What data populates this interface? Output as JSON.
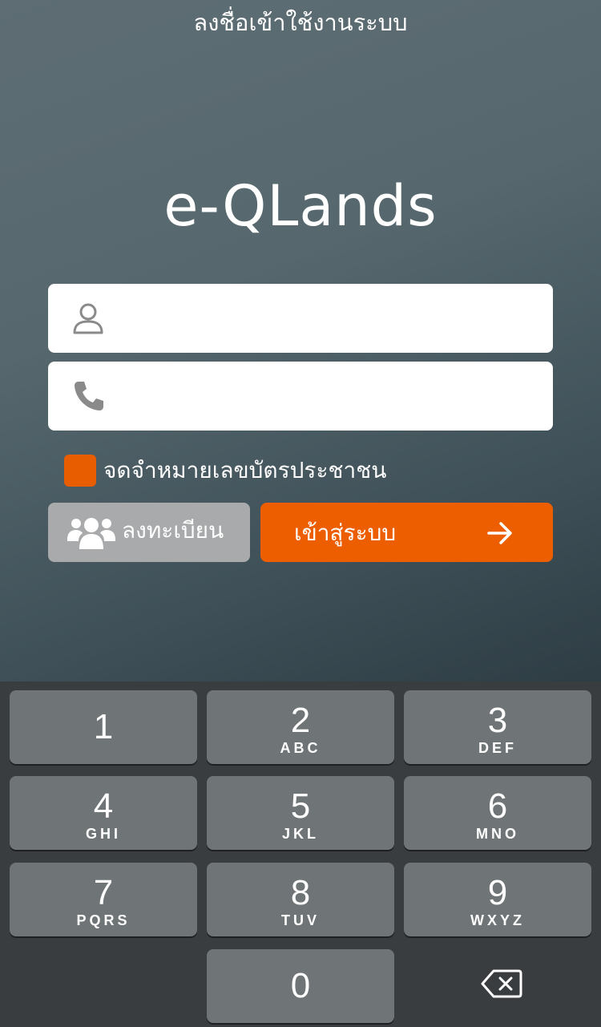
{
  "header": {
    "title": "ลงชื่อเข้าใช้งานระบบ"
  },
  "app": {
    "logo_text": "e-QLands"
  },
  "form": {
    "username": {
      "icon": "user-icon",
      "value": "",
      "placeholder": ""
    },
    "phone": {
      "icon": "phone-icon",
      "value": "",
      "placeholder": ""
    },
    "remember": {
      "label": "จดจำหมายเลขบัตรประชาชน",
      "checked": true,
      "color": "#e85d00"
    }
  },
  "buttons": {
    "register": {
      "label": "ลงทะเบียน",
      "icon": "people-icon",
      "color": "#a8aaab"
    },
    "login": {
      "label": "เข้าสู่ระบบ",
      "icon": "arrow-right-icon",
      "color": "#ed5e00"
    }
  },
  "keypad": {
    "keys": [
      {
        "digit": "1",
        "letters": ""
      },
      {
        "digit": "2",
        "letters": "ABC"
      },
      {
        "digit": "3",
        "letters": "DEF"
      },
      {
        "digit": "4",
        "letters": "GHI"
      },
      {
        "digit": "5",
        "letters": "JKL"
      },
      {
        "digit": "6",
        "letters": "MNO"
      },
      {
        "digit": "7",
        "letters": "PQRS"
      },
      {
        "digit": "8",
        "letters": "TUV"
      },
      {
        "digit": "9",
        "letters": "WXYZ"
      },
      {
        "digit": "0",
        "letters": ""
      }
    ],
    "delete_icon": "backspace-icon"
  }
}
